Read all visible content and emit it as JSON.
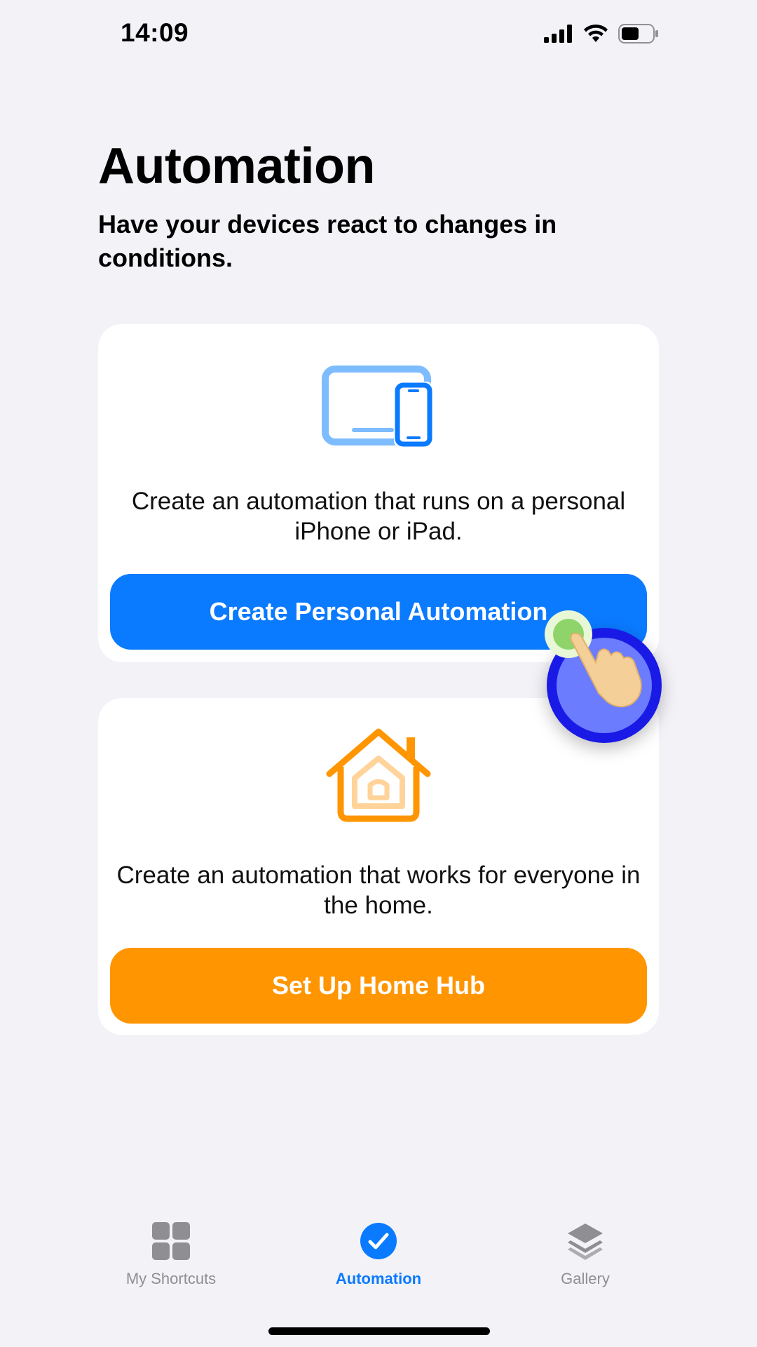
{
  "status_bar": {
    "time": "14:09"
  },
  "header": {
    "title": "Automation",
    "subtitle": "Have your devices react to changes in conditions."
  },
  "personal_card": {
    "icon": "devices-icon",
    "description": "Create an automation that runs on a personal iPhone or iPad.",
    "button_label": "Create Personal Automation"
  },
  "home_card": {
    "icon": "home-icon",
    "description": "Create an automation that works for everyone in the home.",
    "button_label": "Set Up Home Hub"
  },
  "tab_bar": {
    "tabs": [
      {
        "label": "My Shortcuts",
        "icon": "grid-icon",
        "active": false
      },
      {
        "label": "Automation",
        "icon": "checkmark-circle-icon",
        "active": true
      },
      {
        "label": "Gallery",
        "icon": "layers-icon",
        "active": false
      }
    ]
  },
  "colors": {
    "accent_blue": "#0a7aff",
    "accent_orange": "#ff9500",
    "background": "#f2f2f7",
    "tab_inactive": "#8e8e93"
  }
}
